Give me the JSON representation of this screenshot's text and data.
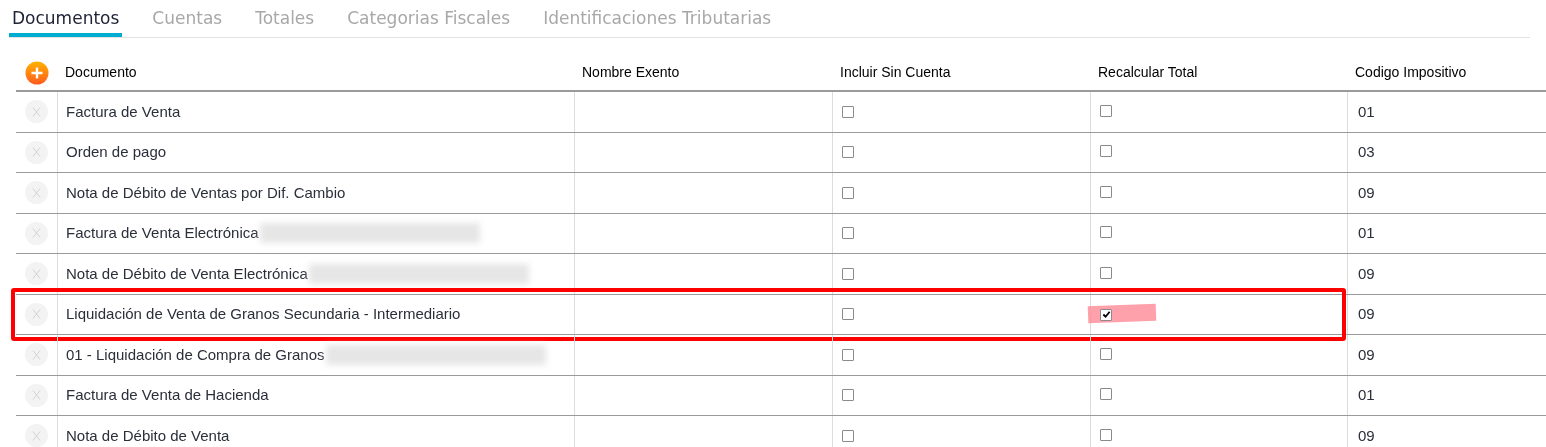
{
  "tabs": [
    {
      "label": "Documentos",
      "selected": true
    },
    {
      "label": "Cuentas",
      "selected": false
    },
    {
      "label": "Totales",
      "selected": false
    },
    {
      "label": "Categorias Fiscales",
      "selected": false
    },
    {
      "label": "Identificaciones Tributarias",
      "selected": false
    }
  ],
  "table": {
    "columns": [
      "Documento",
      "Nombre Exento",
      "Incluir Sin Cuenta",
      "Recalcular Total",
      "Codigo Impositivo"
    ],
    "rows": [
      {
        "documento": "Factura de Venta",
        "redacted": false,
        "incluir_sin_cuenta": false,
        "recalcular_total": false,
        "codigo": "01",
        "highlighted": false,
        "check_marked": false
      },
      {
        "documento": "Orden de pago",
        "redacted": false,
        "incluir_sin_cuenta": false,
        "recalcular_total": false,
        "codigo": "03",
        "highlighted": false,
        "check_marked": false
      },
      {
        "documento": "Nota de Débito de Ventas por Dif. Cambio",
        "redacted": false,
        "incluir_sin_cuenta": false,
        "recalcular_total": false,
        "codigo": "09",
        "highlighted": false,
        "check_marked": false
      },
      {
        "documento": "Factura de Venta Electrónica",
        "redacted": true,
        "incluir_sin_cuenta": false,
        "recalcular_total": false,
        "codigo": "01",
        "highlighted": false,
        "check_marked": false
      },
      {
        "documento": "Nota de Débito de Venta Electrónica",
        "redacted": true,
        "incluir_sin_cuenta": false,
        "recalcular_total": false,
        "codigo": "09",
        "highlighted": false,
        "check_marked": false
      },
      {
        "documento": "Liquidación de Venta de Granos Secundaria - Intermediario",
        "redacted": false,
        "incluir_sin_cuenta": false,
        "recalcular_total": true,
        "codigo": "09",
        "highlighted": true,
        "check_marked": true
      },
      {
        "documento": "01 - Liquidación de Compra de Granos",
        "redacted": true,
        "incluir_sin_cuenta": false,
        "recalcular_total": false,
        "codigo": "09",
        "highlighted": false,
        "check_marked": false
      },
      {
        "documento": "Factura de Venta de Hacienda",
        "redacted": false,
        "incluir_sin_cuenta": false,
        "recalcular_total": false,
        "codigo": "01",
        "highlighted": false,
        "check_marked": false
      },
      {
        "documento": "Nota de Débito de Venta",
        "redacted": false,
        "incluir_sin_cuenta": false,
        "recalcular_total": false,
        "codigo": "09",
        "highlighted": false,
        "check_marked": false
      }
    ]
  }
}
